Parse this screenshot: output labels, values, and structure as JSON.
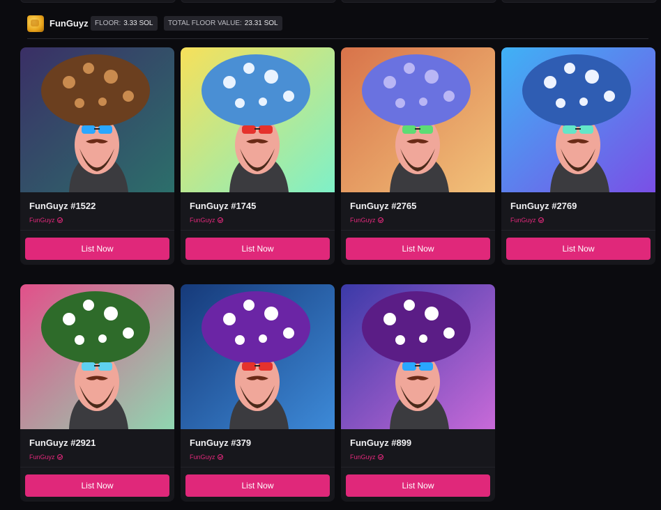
{
  "header": {
    "collection_name": "FunGuyz",
    "floor_label": "FLOOR:",
    "floor_value": "3.33 SOL",
    "total_label": "TOTAL FLOOR VALUE:",
    "total_value": "23.31 SOL"
  },
  "items": [
    {
      "title": "FunGuyz #1522",
      "collection": "FunGuyz",
      "button": "List Now",
      "bg1": "#3a2f66",
      "bg2": "#2c6f6b",
      "cap": "#6b3f1f",
      "spots": "#c98b4f",
      "glasses": "#2aa7ff"
    },
    {
      "title": "FunGuyz #1745",
      "collection": "FunGuyz",
      "button": "List Now",
      "bg1": "#f7e05a",
      "bg2": "#7ef0c8",
      "cap": "#4a8fd4",
      "spots": "#e9f3ff",
      "glasses": "#e5322c"
    },
    {
      "title": "FunGuyz #2765",
      "collection": "FunGuyz",
      "button": "List Now",
      "bg1": "#d8734a",
      "bg2": "#f2c27a",
      "cap": "#6a72e0",
      "spots": "#b9b6f5",
      "glasses": "#5ddc74"
    },
    {
      "title": "FunGuyz #2769",
      "collection": "FunGuyz",
      "button": "List Now",
      "bg1": "#3fb2f5",
      "bg2": "#7a4fe6",
      "cap": "#2f5db3",
      "spots": "#eef3ff",
      "glasses": "#63e6c8"
    },
    {
      "title": "FunGuyz #2921",
      "collection": "FunGuyz",
      "button": "List Now",
      "bg1": "#e2508a",
      "bg2": "#8fd6b0",
      "cap": "#2e6b2a",
      "spots": "#ffffff",
      "glasses": "#5fd1f0"
    },
    {
      "title": "FunGuyz #379",
      "collection": "FunGuyz",
      "button": "List Now",
      "bg1": "#163a7a",
      "bg2": "#3d8ad8",
      "cap": "#6b25a5",
      "spots": "#ffffff",
      "glasses": "#e5322c"
    },
    {
      "title": "FunGuyz #899",
      "collection": "FunGuyz",
      "button": "List Now",
      "bg1": "#3b3aa8",
      "bg2": "#c86ad8",
      "cap": "#5b1d86",
      "spots": "#ffffff",
      "glasses": "#2aa7ff"
    }
  ]
}
